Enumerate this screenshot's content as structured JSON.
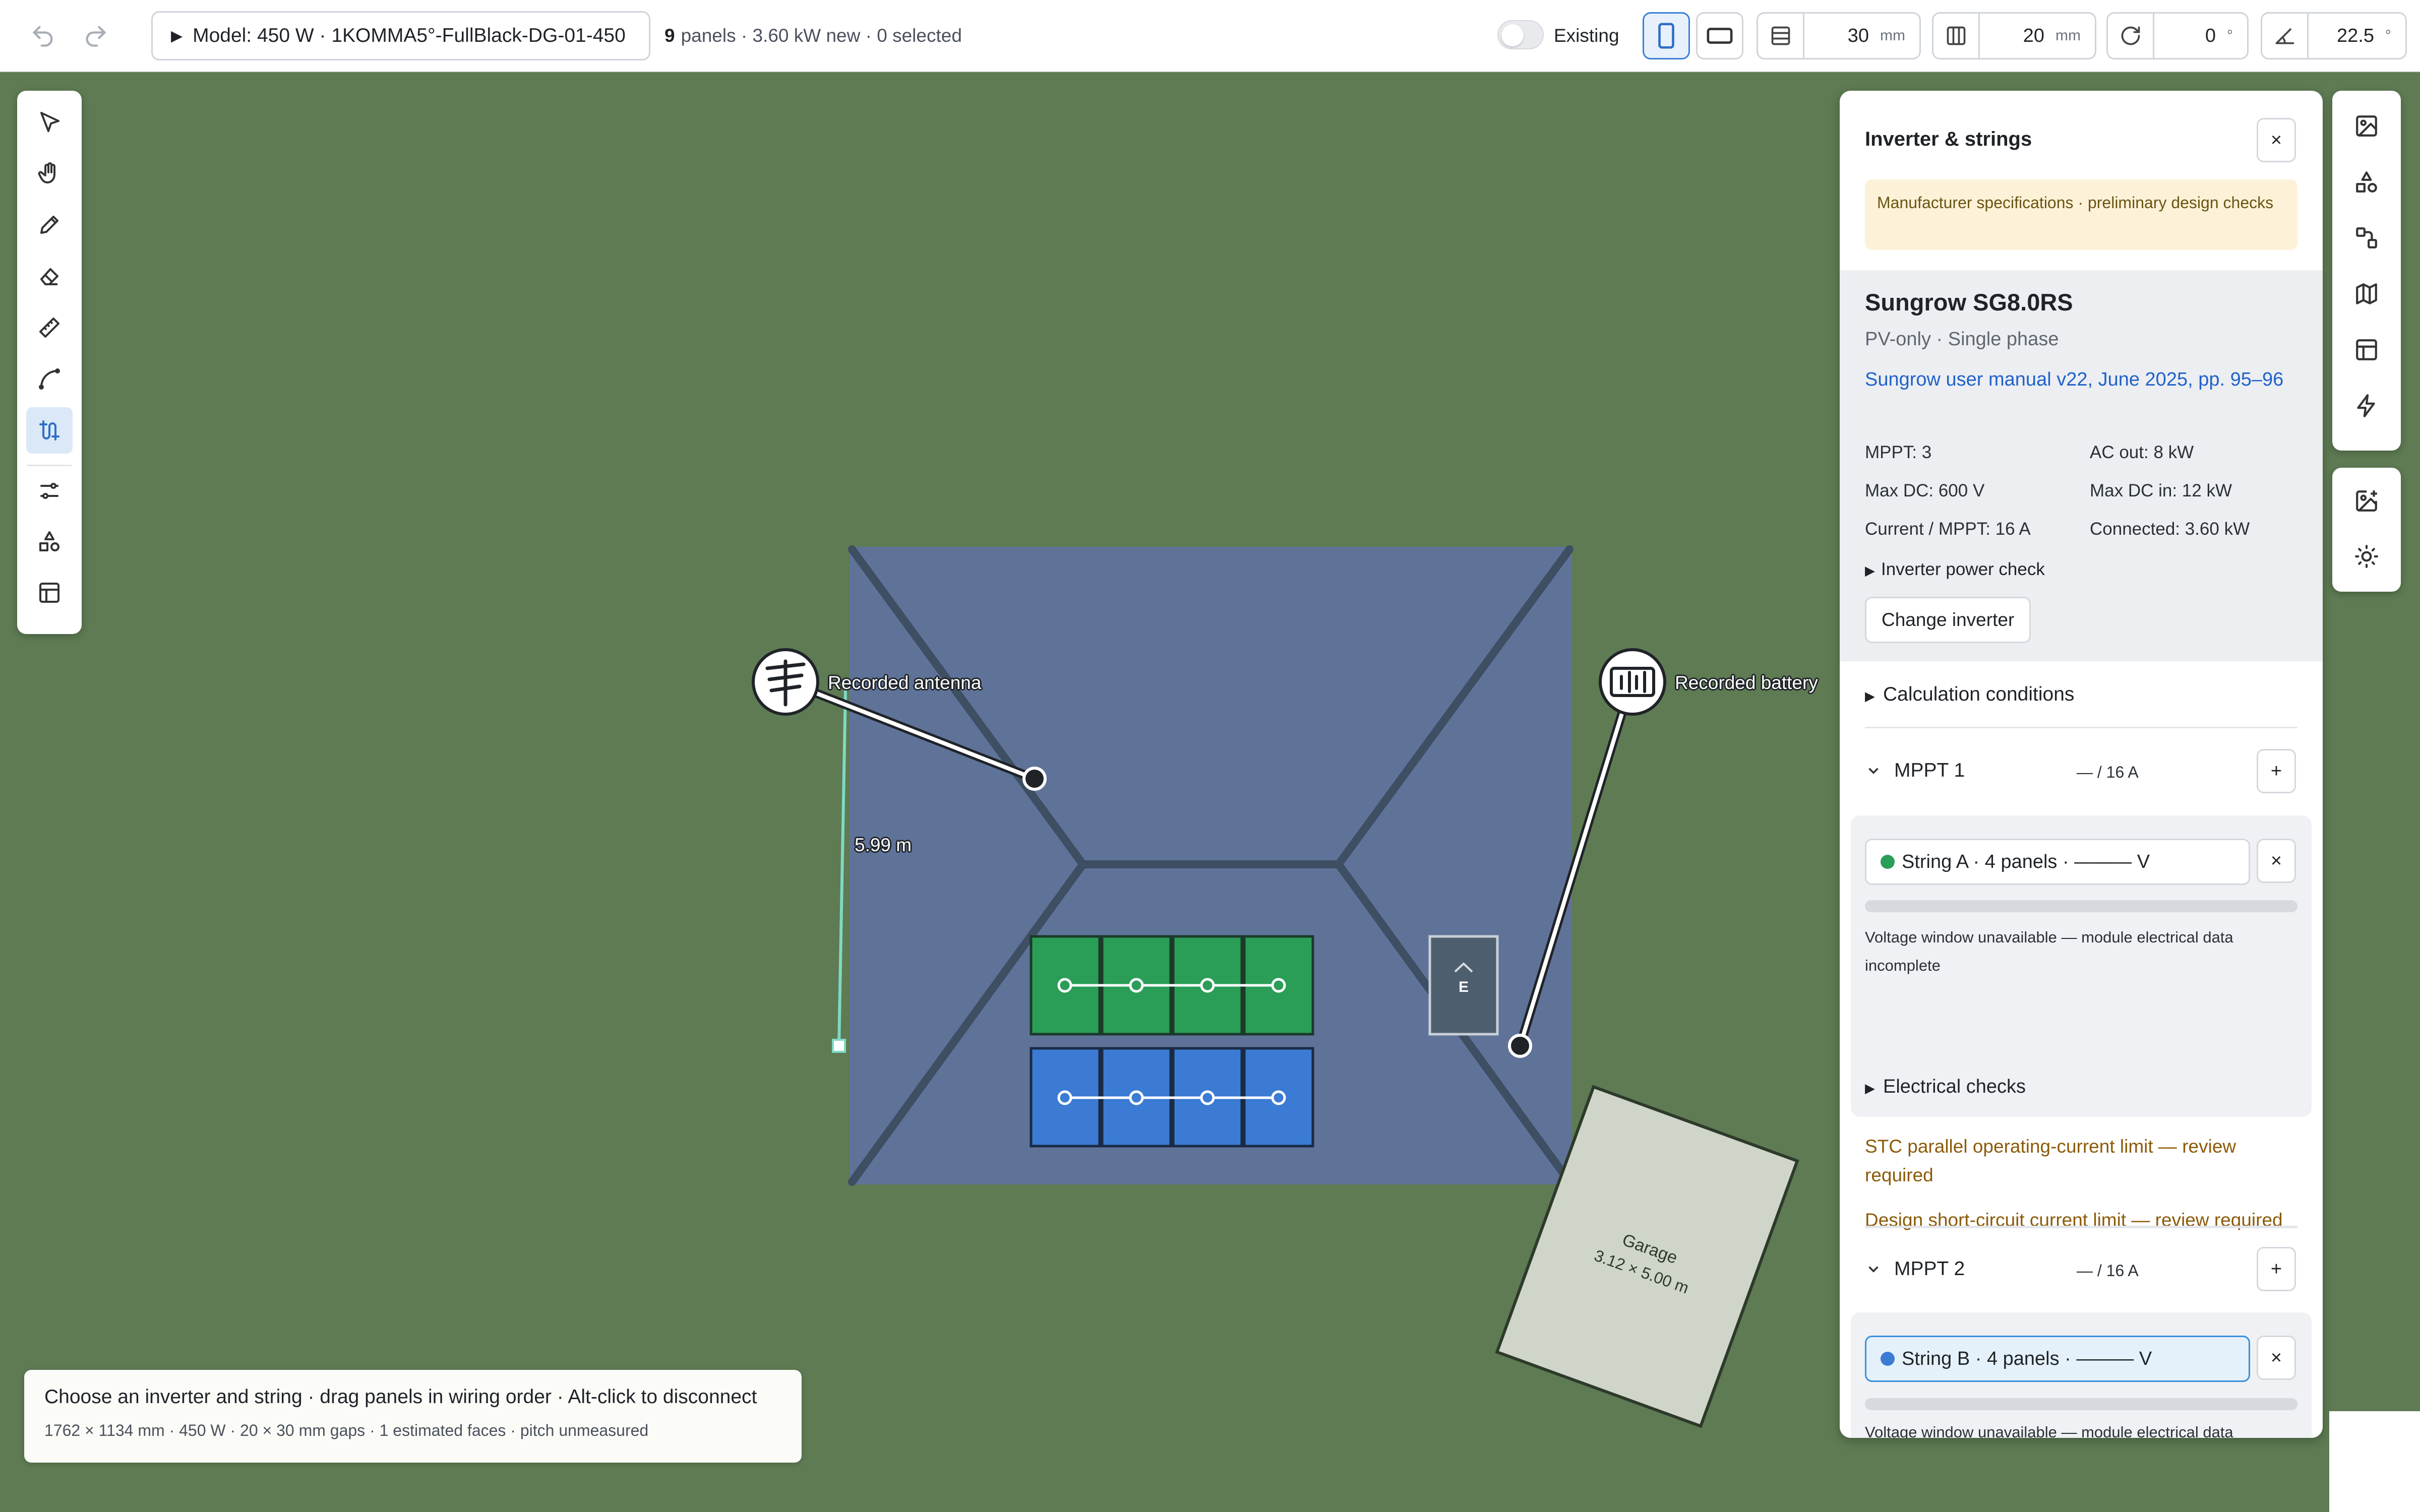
{
  "toolbar": {
    "undo_icon": "undo-icon",
    "redo_icon": "redo-icon",
    "model_caret": "▶",
    "model_label": "Model: 450 W · 1KOMMA5°-FullBlack-DG-01-450",
    "panel_count": "9",
    "summary_rest": "panels · 3.60 kW new · 0 selected",
    "existing_label": "Existing",
    "row_gap_value": "30",
    "row_gap_unit": "mm",
    "col_gap_value": "20",
    "col_gap_unit": "mm",
    "rotation_value": "0",
    "rotation_unit": "°",
    "tilt_value": "22.5",
    "tilt_unit": "°"
  },
  "canvas": {
    "antenna_label": "Recorded antenna",
    "battery_label": "Recorded battery",
    "distance_label": "5.99 m",
    "garage_name": "Garage",
    "garage_dims": "3.12 × 5.00 m",
    "meter_label": "E",
    "colors": {
      "ground": "#5e7b53",
      "roof": "#5f7399",
      "roof_lines": "#3e4e63",
      "string_a": "#2a9d57",
      "string_b": "#3b7bd4",
      "garage": "#cfd5c8",
      "measure": "#7fd8c4"
    }
  },
  "panel": {
    "title": "Inverter & strings",
    "close": "×",
    "warning": "Manufacturer specifications · preliminary design checks",
    "inverter": {
      "name": "Sungrow SG8.0RS",
      "sub": "PV-only · Single phase",
      "manual_link": "Sungrow user manual v22, June 2025, pp. 95–96",
      "specs": [
        "MPPT: 3",
        "AC out: 8 kW",
        "Max DC: 600 V",
        "Max DC in: 12 kW",
        "Current / MPPT: 16 A",
        "Connected: 3.60 kW"
      ],
      "power_check": "Inverter power check",
      "change_btn": "Change inverter"
    },
    "calc_conditions": "Calculation conditions",
    "mppt1": {
      "title": "MPPT 1",
      "current": "— / 16 A",
      "add": "+",
      "string_label": "String A · 4 panels · ——— V",
      "remove": "×",
      "voltage_msg": "Voltage window unavailable — module electrical data incomplete",
      "electrical_checks": "Electrical checks",
      "limit1": "STC parallel operating-current limit — review required",
      "limit2": "Design short-circuit current limit — review required"
    },
    "mppt2": {
      "title": "MPPT 2",
      "current": "— / 16 A",
      "add": "+",
      "string_label": "String B · 4 panels · ——— V",
      "remove": "×",
      "voltage_msg_partial": "Voltage window unavailable — module electrical data incomplete"
    }
  },
  "hint": {
    "main": "Choose an inverter and string · drag panels in wiring order · Alt-click to disconnect",
    "sub": "1762 × 1134 mm · 450 W · 20 × 30 mm gaps · 1 estimated faces · pitch unmeasured"
  },
  "left_tools": [
    "select-tool-icon",
    "pan-tool-icon",
    "draw-tool-icon",
    "eraser-tool-icon",
    "measure-tool-icon",
    "arc-tool-icon",
    "wiring-tool-icon",
    "settings-sliders-icon",
    "shapes-icon",
    "layout-icon"
  ],
  "right_tools": [
    "image-icon",
    "shapes-icon",
    "connections-icon",
    "map-icon",
    "layout-icon",
    "bolt-icon",
    "add-image-icon",
    "sun-icon"
  ]
}
